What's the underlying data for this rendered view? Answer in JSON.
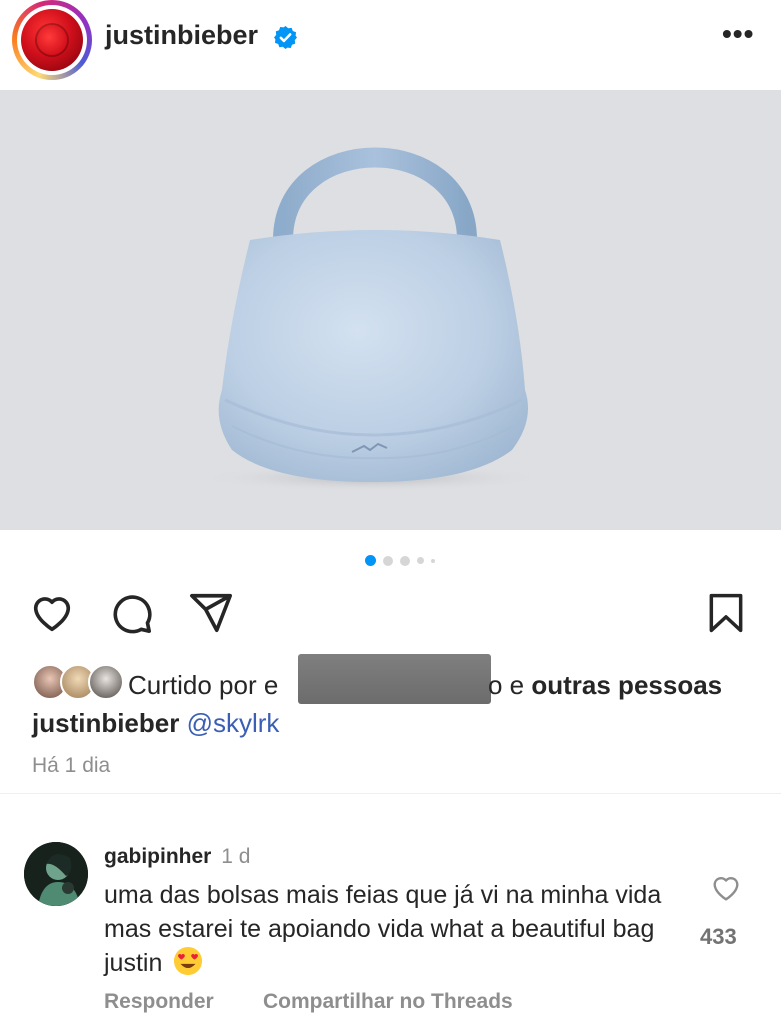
{
  "post": {
    "username": "justinbieber",
    "verified_icon": "verified-badge-icon",
    "more_label": "•••",
    "carousel": {
      "count": 5,
      "active_index": 0
    },
    "likes": {
      "prefix": "Curtido por e",
      "suffix_plain": "o e ",
      "suffix_bold": "outras pessoas"
    },
    "caption": {
      "username": "justinbieber",
      "mention": "@skylrk"
    },
    "timestamp": "Há 1 dia"
  },
  "comment": {
    "username": "gabipinher",
    "time": "1 d",
    "text": "uma das bolsas mais feias que já vi na minha vida mas estarei te apoiando vida what a beautiful bag justin",
    "like_count": "433",
    "reply_label": "Responder",
    "share_label": "Compartilhar no Threads"
  },
  "colors": {
    "accent_blue": "#0095f6",
    "mention_blue": "#3b5fb5",
    "muted_gray": "#8e8e8e",
    "photo_background": "#dedfe2",
    "bag_color": "#b9cde3"
  }
}
